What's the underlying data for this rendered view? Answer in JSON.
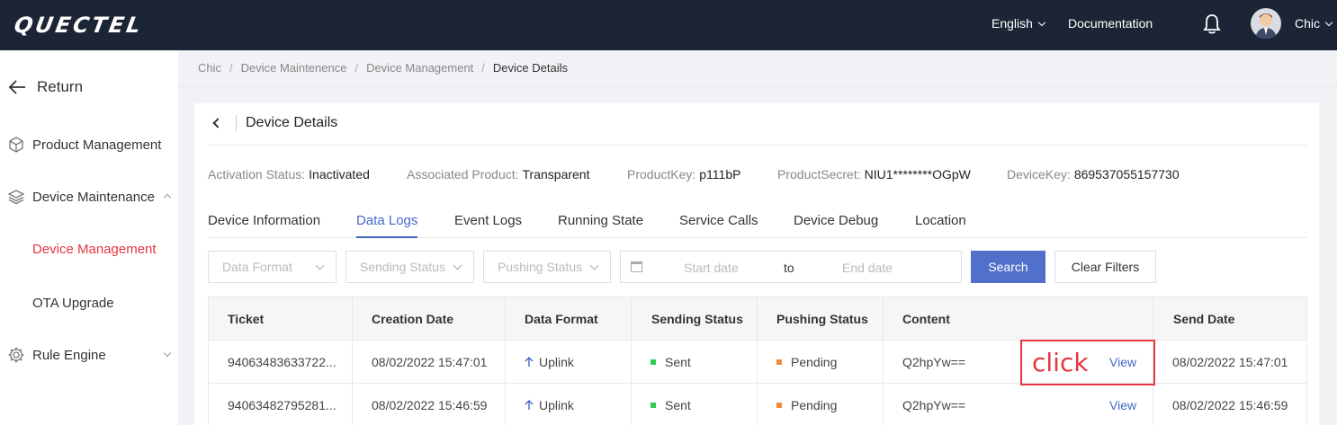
{
  "topbar": {
    "logo": "QUECTEL",
    "language": "English",
    "documentation": "Documentation",
    "user": "Chic"
  },
  "sidebar": {
    "return_label": "Return",
    "items": [
      {
        "label": "Product Management"
      },
      {
        "label": "Device Maintenance"
      },
      {
        "label": "Device Management"
      },
      {
        "label": "OTA Upgrade"
      },
      {
        "label": "Rule Engine"
      }
    ]
  },
  "breadcrumb": [
    "Chic",
    "Device Maintenence",
    "Device Management",
    "Device Details"
  ],
  "breadcrumb_sep": "/",
  "card": {
    "title": "Device Details",
    "info": [
      {
        "key": "Activation Status:",
        "value": "Inactivated"
      },
      {
        "key": "Associated Product:",
        "value": "Transparent"
      },
      {
        "key": "ProductKey:",
        "value": "p111bP"
      },
      {
        "key": "ProductSecret:",
        "value": "NIU1********OGpW"
      },
      {
        "key": "DeviceKey:",
        "value": "869537055157730"
      }
    ],
    "tabs": [
      "Device Information",
      "Data Logs",
      "Event Logs",
      "Running State",
      "Service Calls",
      "Device Debug",
      "Location"
    ],
    "active_tab": "Data Logs"
  },
  "filters": {
    "data_format": "Data Format",
    "sending_status": "Sending Status",
    "pushing_status": "Pushing Status",
    "start_date": "Start date",
    "to": "to",
    "end_date": "End date",
    "search": "Search",
    "clear": "Clear Filters"
  },
  "table": {
    "headers": [
      "Ticket",
      "Creation Date",
      "Data Format",
      "Sending Status",
      "Pushing Status",
      "Content",
      "Send Date"
    ],
    "rows": [
      {
        "ticket": "94063483633722...",
        "creation_date": "08/02/2022 15:47:01",
        "data_format": "Uplink",
        "sending_status": "Sent",
        "pushing_status": "Pending",
        "content": "Q2hpYw==",
        "action": "View",
        "send_date": "08/02/2022 15:47:01"
      },
      {
        "ticket": "94063482795281...",
        "creation_date": "08/02/2022 15:46:59",
        "data_format": "Uplink",
        "sending_status": "Sent",
        "pushing_status": "Pending",
        "content": "Q2hpYw==",
        "action": "View",
        "send_date": "08/02/2022 15:46:59"
      }
    ]
  },
  "annotation": {
    "text": "click"
  },
  "colors": {
    "accent": "#4468c6",
    "active_menu": "#e5373f",
    "sent": "#2ecc55",
    "pending": "#f08c3c",
    "topbar": "#1c2536"
  }
}
